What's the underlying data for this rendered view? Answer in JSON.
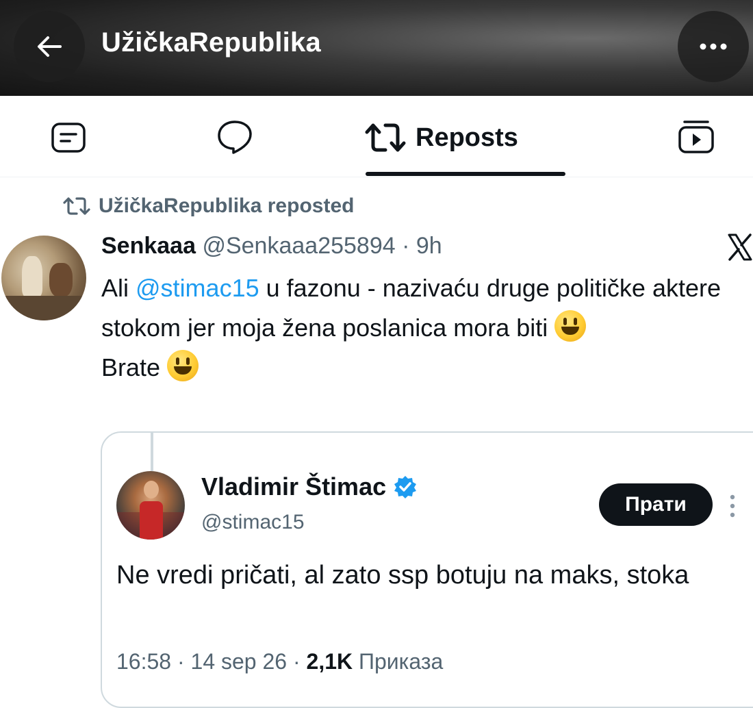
{
  "header": {
    "title": "UžičkaRepublika"
  },
  "tabs": {
    "active_label": "Reposts"
  },
  "repost": {
    "context": "UžičkaRepublika reposted"
  },
  "tweet": {
    "author_name": "Senkaaa",
    "author_handle": "@Senkaaa255894",
    "separator": " · ",
    "time": "9h",
    "text_before_mention": "Ali ",
    "mention": "@stimac15",
    "text_after_mention": " u fazonu - nazivaću druge političke aktere stokom jer moja žena poslanica mora biti ",
    "line2": "Brate "
  },
  "quoted": {
    "author_name": "Vladimir Štimac",
    "author_handle": "@stimac15",
    "follow_label": "Прати",
    "text": "Ne vredi pričati, al zato ssp botuju na maks, stoka",
    "time": "16:58",
    "date": "14 sep 26",
    "views_count": "2,1K",
    "views_label": "Приказа"
  },
  "colors": {
    "accent": "#1d9bf0",
    "text_primary": "#0f1419",
    "text_secondary": "#536471",
    "border": "#cfd9de"
  }
}
